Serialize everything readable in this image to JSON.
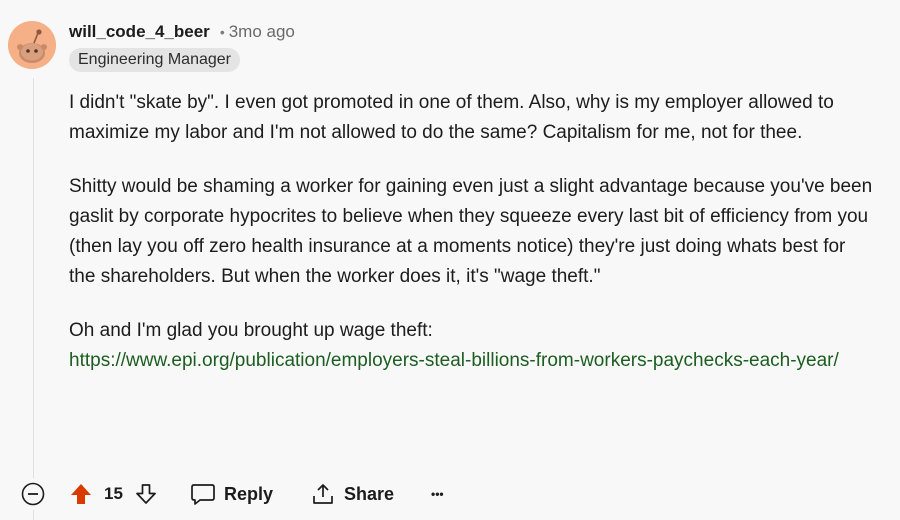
{
  "comment": {
    "username": "will_code_4_beer",
    "separator": "•",
    "time_ago": "3mo ago",
    "flair": "Engineering Manager",
    "paragraphs": [
      "I didn't \"skate by\". I even got promoted in one of them. Also, why is my employer allowed to maximize my labor and I'm not allowed to do the same? Capitalism for me, not for thee.",
      "Shitty would be shaming a worker for gaining even just a slight advantage because you've been gaslit by corporate hypocrites to believe when they squeeze every last bit of efficiency from you (then lay you off zero health insurance at a moments notice) they're just doing whats best for the shareholders. But when the worker does it, it's \"wage theft.\"",
      "Oh and I'm glad you brought up wage theft:"
    ],
    "link": "https://www.epi.org/publication/employers-steal-billions-from-workers-paychecks-each-year/"
  },
  "actions": {
    "vote_count": "15",
    "reply_label": "Reply",
    "share_label": "Share",
    "more_label": "•••"
  },
  "colors": {
    "upvote_active": "#d93a00",
    "link": "#1b5e20",
    "avatar_bg": "#f5b088"
  },
  "icons": [
    "collapse-icon",
    "upvote-icon",
    "downvote-icon",
    "comment-icon",
    "share-icon",
    "more-icon",
    "avatar-icon"
  ]
}
